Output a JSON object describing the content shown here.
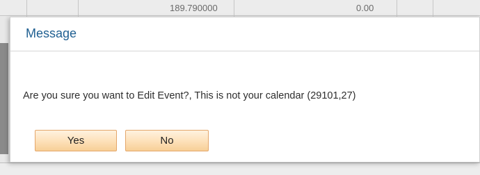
{
  "background": {
    "cells": [
      "189.790000",
      "0.00"
    ]
  },
  "dialog": {
    "title": "Message",
    "message": "Are you sure you want to Edit Event?, This is not your calendar (29101,27)",
    "buttons": {
      "yes_label": "Yes",
      "no_label": "No"
    }
  },
  "colors": {
    "title": "#1f5f91",
    "button_border": "#e4a66a",
    "button_fill": "#fde0b8"
  }
}
